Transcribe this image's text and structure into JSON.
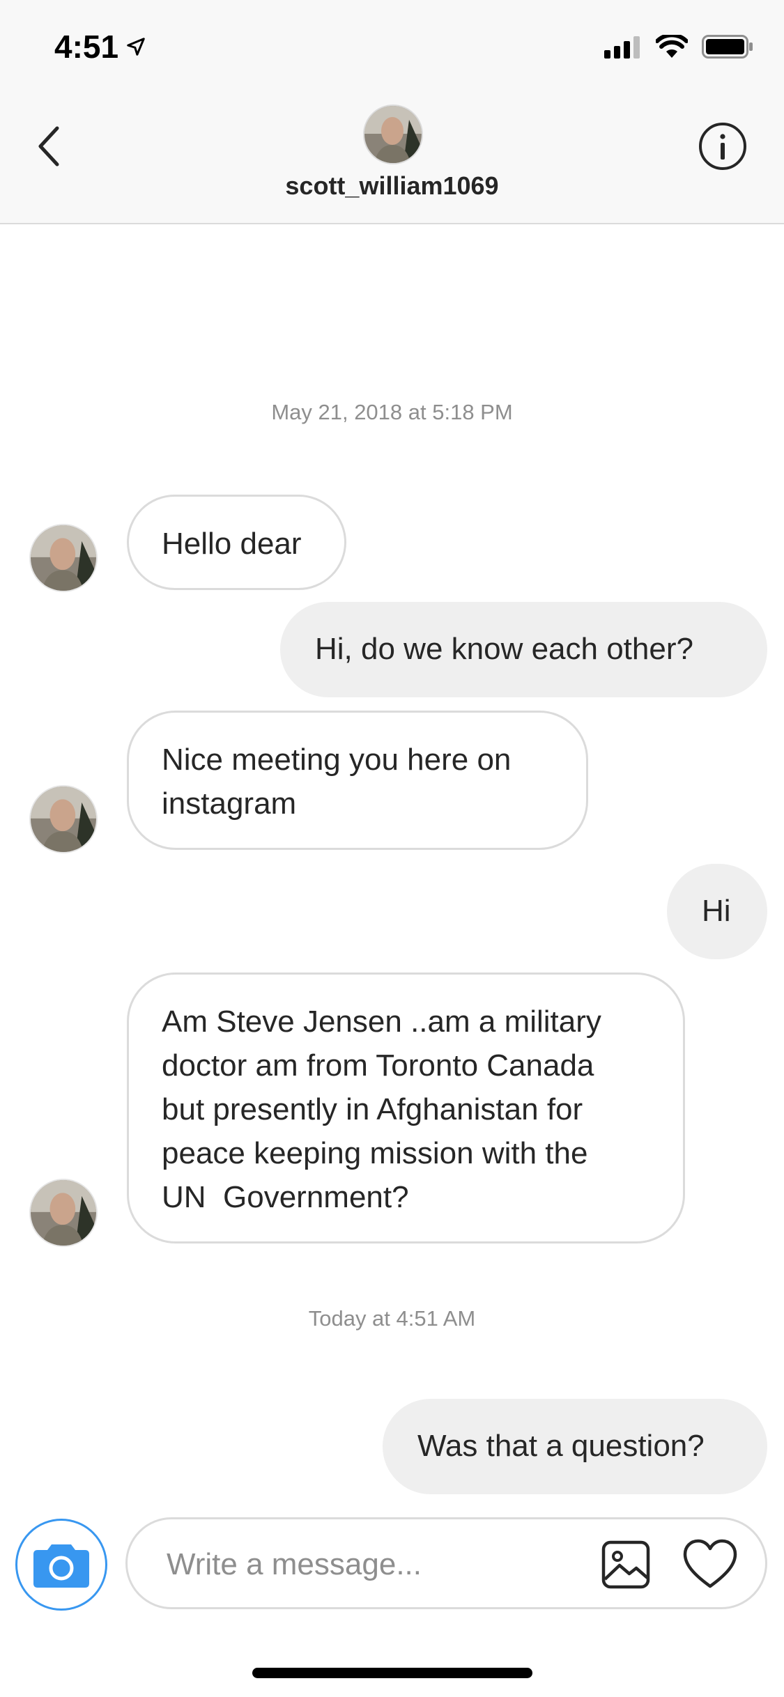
{
  "status_bar": {
    "time": "4:51"
  },
  "header": {
    "username": "scott_william1069"
  },
  "conversation": [
    {
      "type": "timestamp",
      "text": "May 21, 2018 at 5:18 PM"
    },
    {
      "type": "incoming",
      "text": "Hello dear"
    },
    {
      "type": "outgoing",
      "text": "Hi, do we know each other?"
    },
    {
      "type": "incoming",
      "lines": [
        "Nice meeting you here on",
        "instagram"
      ]
    },
    {
      "type": "outgoing",
      "text": "Hi"
    },
    {
      "type": "incoming",
      "lines": [
        "Am Steve Jensen ..am a military",
        "doctor am from Toronto Canada",
        "but presently in Afghanistan for",
        "peace keeping mission with the",
        "UN  Government?"
      ]
    },
    {
      "type": "timestamp",
      "text": "Today at 4:51 AM"
    },
    {
      "type": "outgoing",
      "text": "Was that a question?"
    }
  ],
  "composer": {
    "placeholder": "Write a message..."
  },
  "icons": {
    "back": "chevron-left-icon",
    "info": "info-icon",
    "camera": "camera-icon",
    "gallery": "image-icon",
    "like": "heart-icon",
    "location": "location-arrow-icon",
    "signal": "cellular-signal-icon",
    "wifi": "wifi-icon",
    "battery": "battery-icon"
  },
  "colors": {
    "accent": "#3897f0",
    "bubble_outgoing": "#efefef",
    "bubble_border": "#dbdbdb",
    "meta_text": "#8e8e8e"
  }
}
